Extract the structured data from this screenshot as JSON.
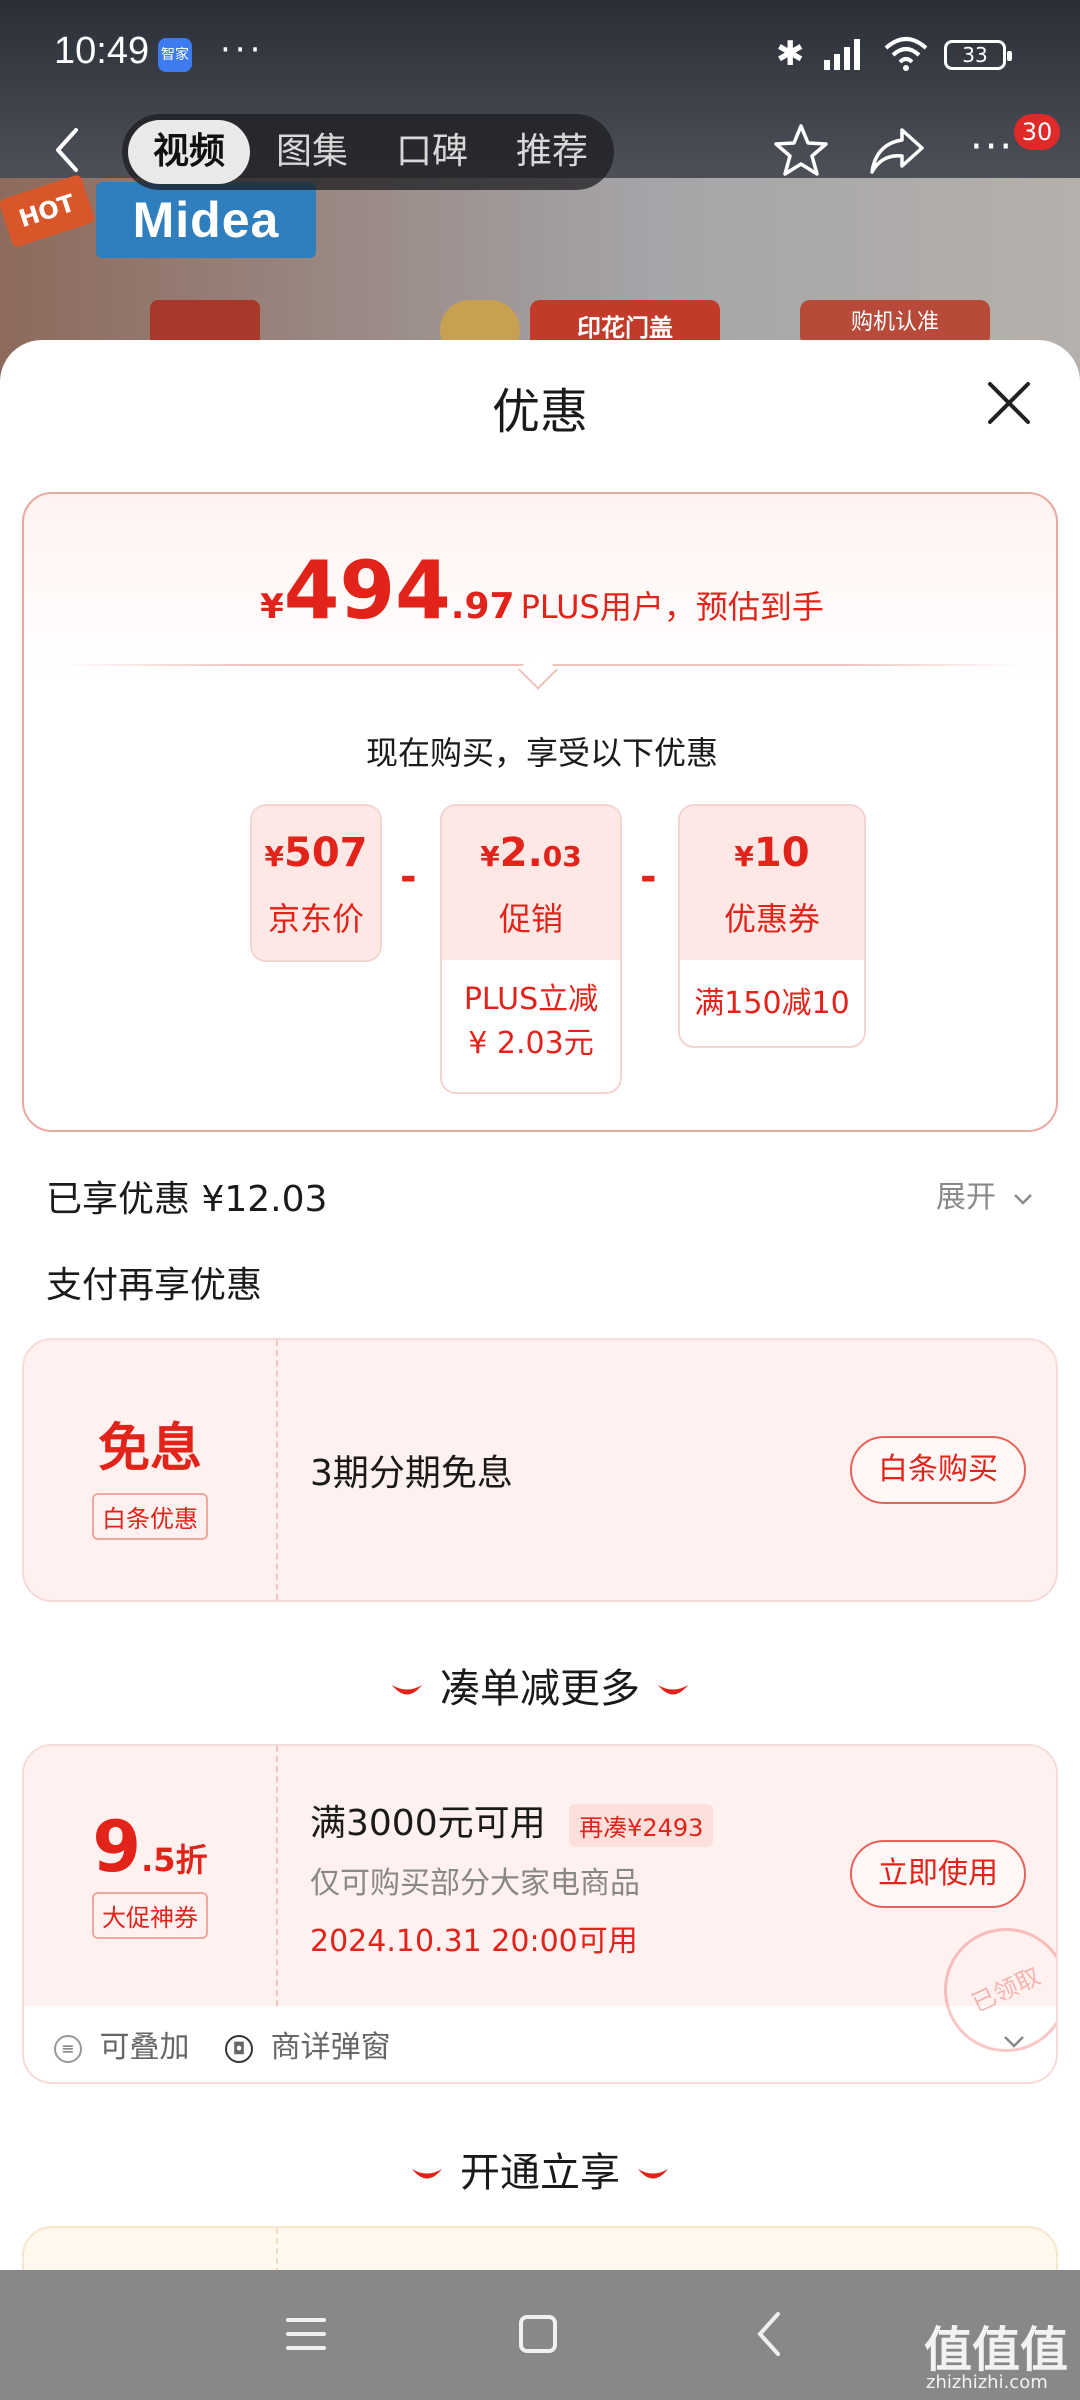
{
  "status_bar": {
    "time": "10:49",
    "app_badge": "智家",
    "battery": "33"
  },
  "nav": {
    "tabs": [
      {
        "label": "视频",
        "active": true
      },
      {
        "label": "图集",
        "active": false
      },
      {
        "label": "口碑",
        "active": false
      },
      {
        "label": "推荐",
        "active": false
      }
    ],
    "cart_count": "30"
  },
  "banner": {
    "hot": "HOT",
    "brand": "Midea",
    "tag1": "印花门盖",
    "tag2": "购机认准"
  },
  "sheet": {
    "title": "优惠",
    "price": {
      "currency": "¥",
      "integer": "494",
      "decimal": ".97",
      "note": "PLUS用户，预估到手"
    },
    "buy_now_text": "现在购买，享受以下优惠",
    "breakdown": [
      {
        "currency": "¥",
        "value": "507",
        "value_small": "",
        "label": "京东价",
        "detail": ""
      },
      {
        "currency": "¥",
        "value": "2.",
        "value_small": "03",
        "label": "促销",
        "detail_line1": "PLUS立减",
        "detail_line2": "¥ 2.03元"
      },
      {
        "currency": "¥",
        "value": "10",
        "value_small": "",
        "label": "优惠券",
        "detail_line1": "满150减10"
      }
    ],
    "minus_sign": "-",
    "enjoyed": "已享优惠 ¥12.03",
    "expand": "展开",
    "pay_more": "支付再享优惠",
    "baitiao": {
      "title": "免息",
      "tag": "白条优惠",
      "desc": "3期分期免息",
      "button": "白条购买"
    },
    "section_more": "凑单减更多",
    "discount_coupon": {
      "value_int": "9",
      "value_rest": ".5折",
      "tag": "大促神券",
      "title": "满3000元可用",
      "gap_tag": "再凑¥2493",
      "scope": "仅可购买部分大家电商品",
      "time": "2024.10.31 20:00可用",
      "button": "立即使用",
      "stamp": "已领取",
      "foot1": "可叠加",
      "foot2": "商详弹窗"
    },
    "section_open": "开通立享"
  },
  "watermark": {
    "main": "值值值",
    "sub": "zhizhizhi.com"
  },
  "colors": {
    "accent": "#e2231a",
    "pale": "#fff1ef",
    "border": "#f6dcd9"
  }
}
